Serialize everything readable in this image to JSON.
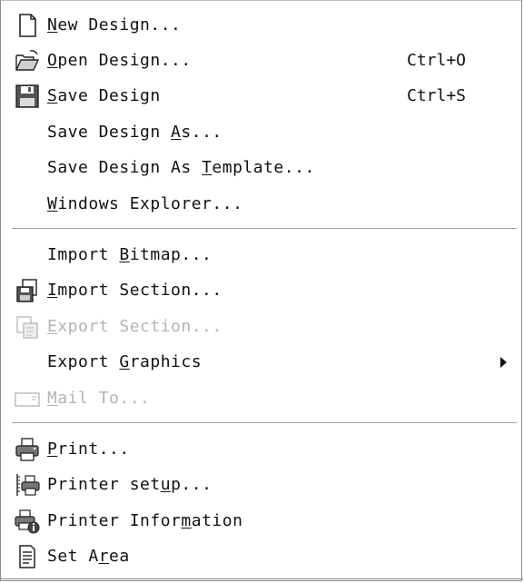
{
  "menu": {
    "items": [
      {
        "pre": "",
        "u": "N",
        "post": "ew Design...",
        "shortcut": "",
        "icon": "new-document-icon"
      },
      {
        "pre": "",
        "u": "O",
        "post": "pen Design...",
        "shortcut": "Ctrl+O",
        "icon": "open-folder-icon"
      },
      {
        "pre": "",
        "u": "S",
        "post": "ave Design",
        "shortcut": "Ctrl+S",
        "icon": "save-disk-icon"
      },
      {
        "pre": "Save Design ",
        "u": "A",
        "post": "s...",
        "shortcut": ""
      },
      {
        "pre": "Save Design As ",
        "u": "T",
        "post": "emplate...",
        "shortcut": ""
      },
      {
        "pre": "",
        "u": "W",
        "post": "indows Explorer...",
        "shortcut": ""
      },
      {
        "pre": "Import ",
        "u": "B",
        "post": "itmap...",
        "shortcut": ""
      },
      {
        "pre": "",
        "u": "I",
        "post": "mport Section...",
        "shortcut": "",
        "icon": "import-section-icon"
      },
      {
        "pre": "",
        "u": "E",
        "post": "xport Section...",
        "shortcut": "",
        "icon": "export-section-icon",
        "disabled": true
      },
      {
        "pre": "Export ",
        "u": "G",
        "post": "raphics",
        "shortcut": "",
        "submenu": true
      },
      {
        "pre": "",
        "u": "M",
        "post": "ail To...",
        "shortcut": "",
        "icon": "mail-icon",
        "disabled": true
      },
      {
        "pre": "",
        "u": "P",
        "post": "rint...",
        "shortcut": "",
        "icon": "printer-icon"
      },
      {
        "pre": "Printer set",
        "u": "u",
        "post": "p...",
        "shortcut": "",
        "icon": "printer-setup-icon"
      },
      {
        "pre": "Printer Infor",
        "u": "m",
        "post": "ation",
        "shortcut": "",
        "icon": "printer-info-icon"
      },
      {
        "pre": "Set A",
        "u": "r",
        "post": "ea",
        "shortcut": "",
        "icon": "set-area-icon"
      }
    ]
  }
}
